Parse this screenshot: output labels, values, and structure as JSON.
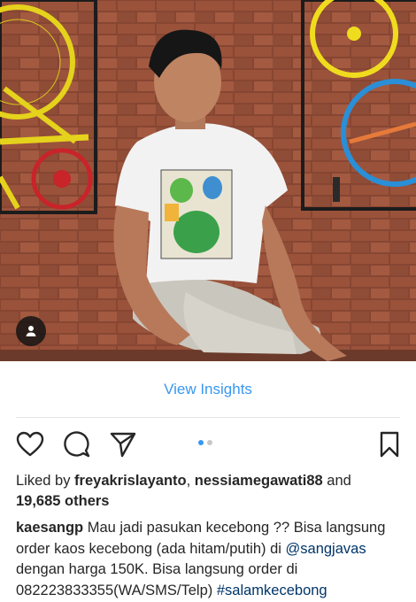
{
  "post": {
    "insights_label": "View Insights",
    "likes": {
      "prefix": "Liked by ",
      "user1": "freyakrislayanto",
      "separator": ", ",
      "user2": "nessiamegawati88",
      "and_text": " and",
      "count": "19,685 others"
    },
    "caption": {
      "username": "kaesangp",
      "text1": " Mau jadi pasukan kecebong ?? Bisa langsung order kaos kecebong (ada hitam/putih) di ",
      "mention": "@sangjavas",
      "text2": " dengan harga 150K. Bisa langsung order di 082223833355(WA/SMS/Telp) ",
      "hashtag": "#salamkecebong"
    },
    "carousel": {
      "count": 2,
      "active": 1
    },
    "icons": {
      "like": "heart-icon",
      "comment": "comment-icon",
      "share": "send-icon",
      "save": "bookmark-icon",
      "tag": "person-tag-icon"
    },
    "colors": {
      "link_blue": "#3897f0",
      "mention": "#003569",
      "text": "#262626"
    }
  }
}
